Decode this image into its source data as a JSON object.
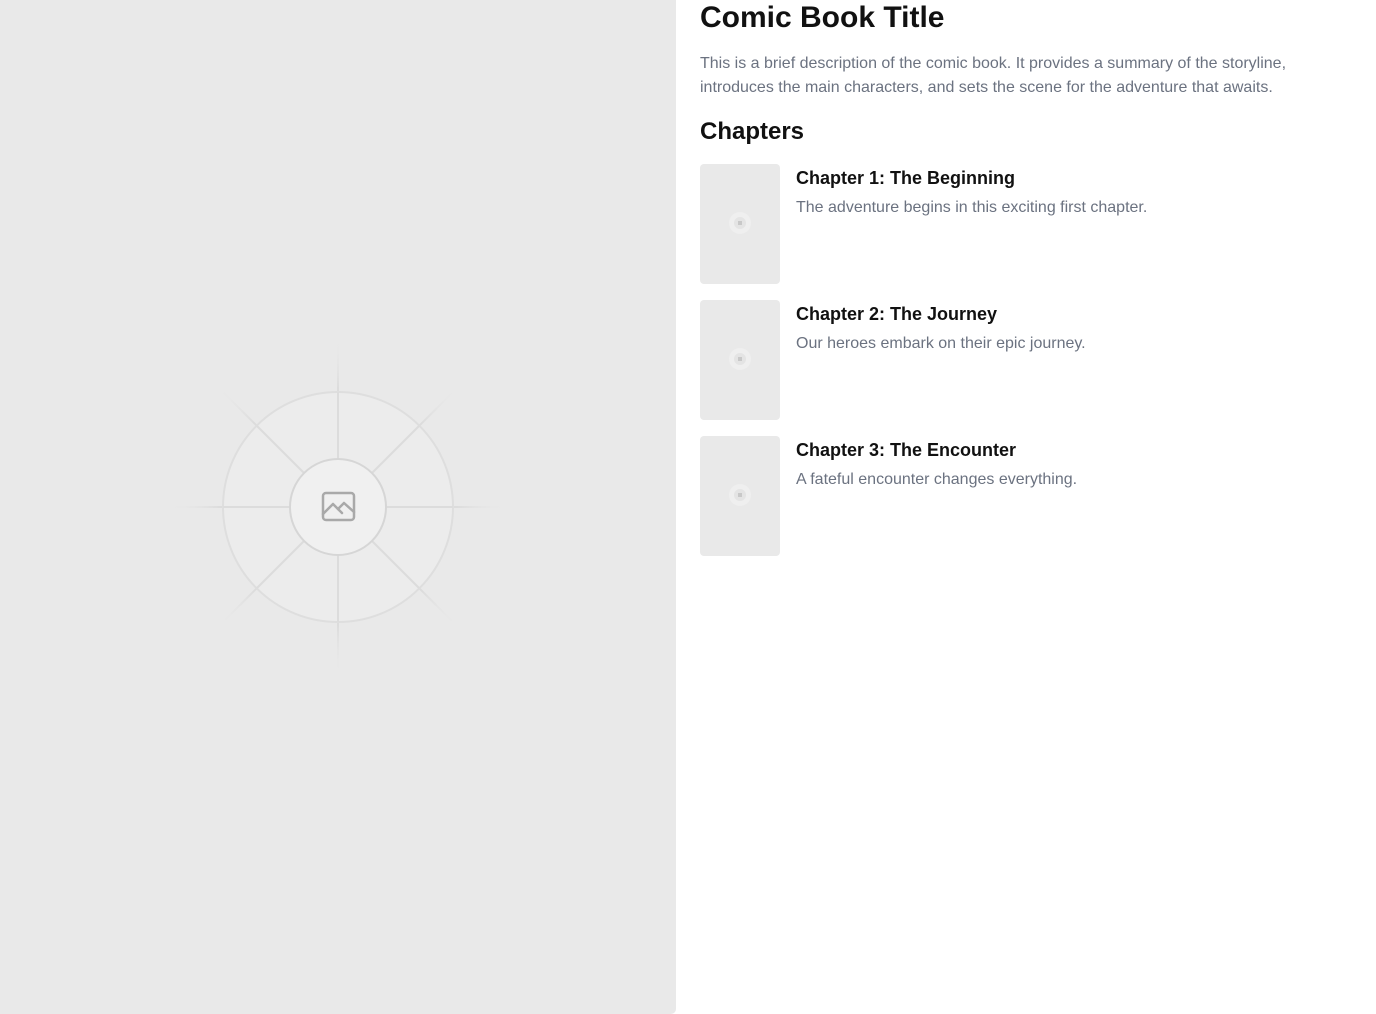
{
  "comic": {
    "title": "Comic Book Title",
    "description": "This is a brief description of the comic book. It provides a summary of the storyline, introduces the main characters, and sets the scene for the adventure that awaits.",
    "cover_icon": "image-placeholder-icon"
  },
  "chapters_section": {
    "heading": "Chapters",
    "items": [
      {
        "title": "Chapter 1: The Beginning",
        "description": "The adventure begins in this exciting first chapter.",
        "thumbnail_icon": "image-placeholder-icon"
      },
      {
        "title": "Chapter 2: The Journey",
        "description": "Our heroes embark on their epic journey.",
        "thumbnail_icon": "image-placeholder-icon"
      },
      {
        "title": "Chapter 3: The Encounter",
        "description": "A fateful encounter changes everything.",
        "thumbnail_icon": "image-placeholder-icon"
      }
    ]
  },
  "colors": {
    "placeholder_bg": "#e9e9e9",
    "heading_text": "#111111",
    "body_text": "#6b7280"
  }
}
